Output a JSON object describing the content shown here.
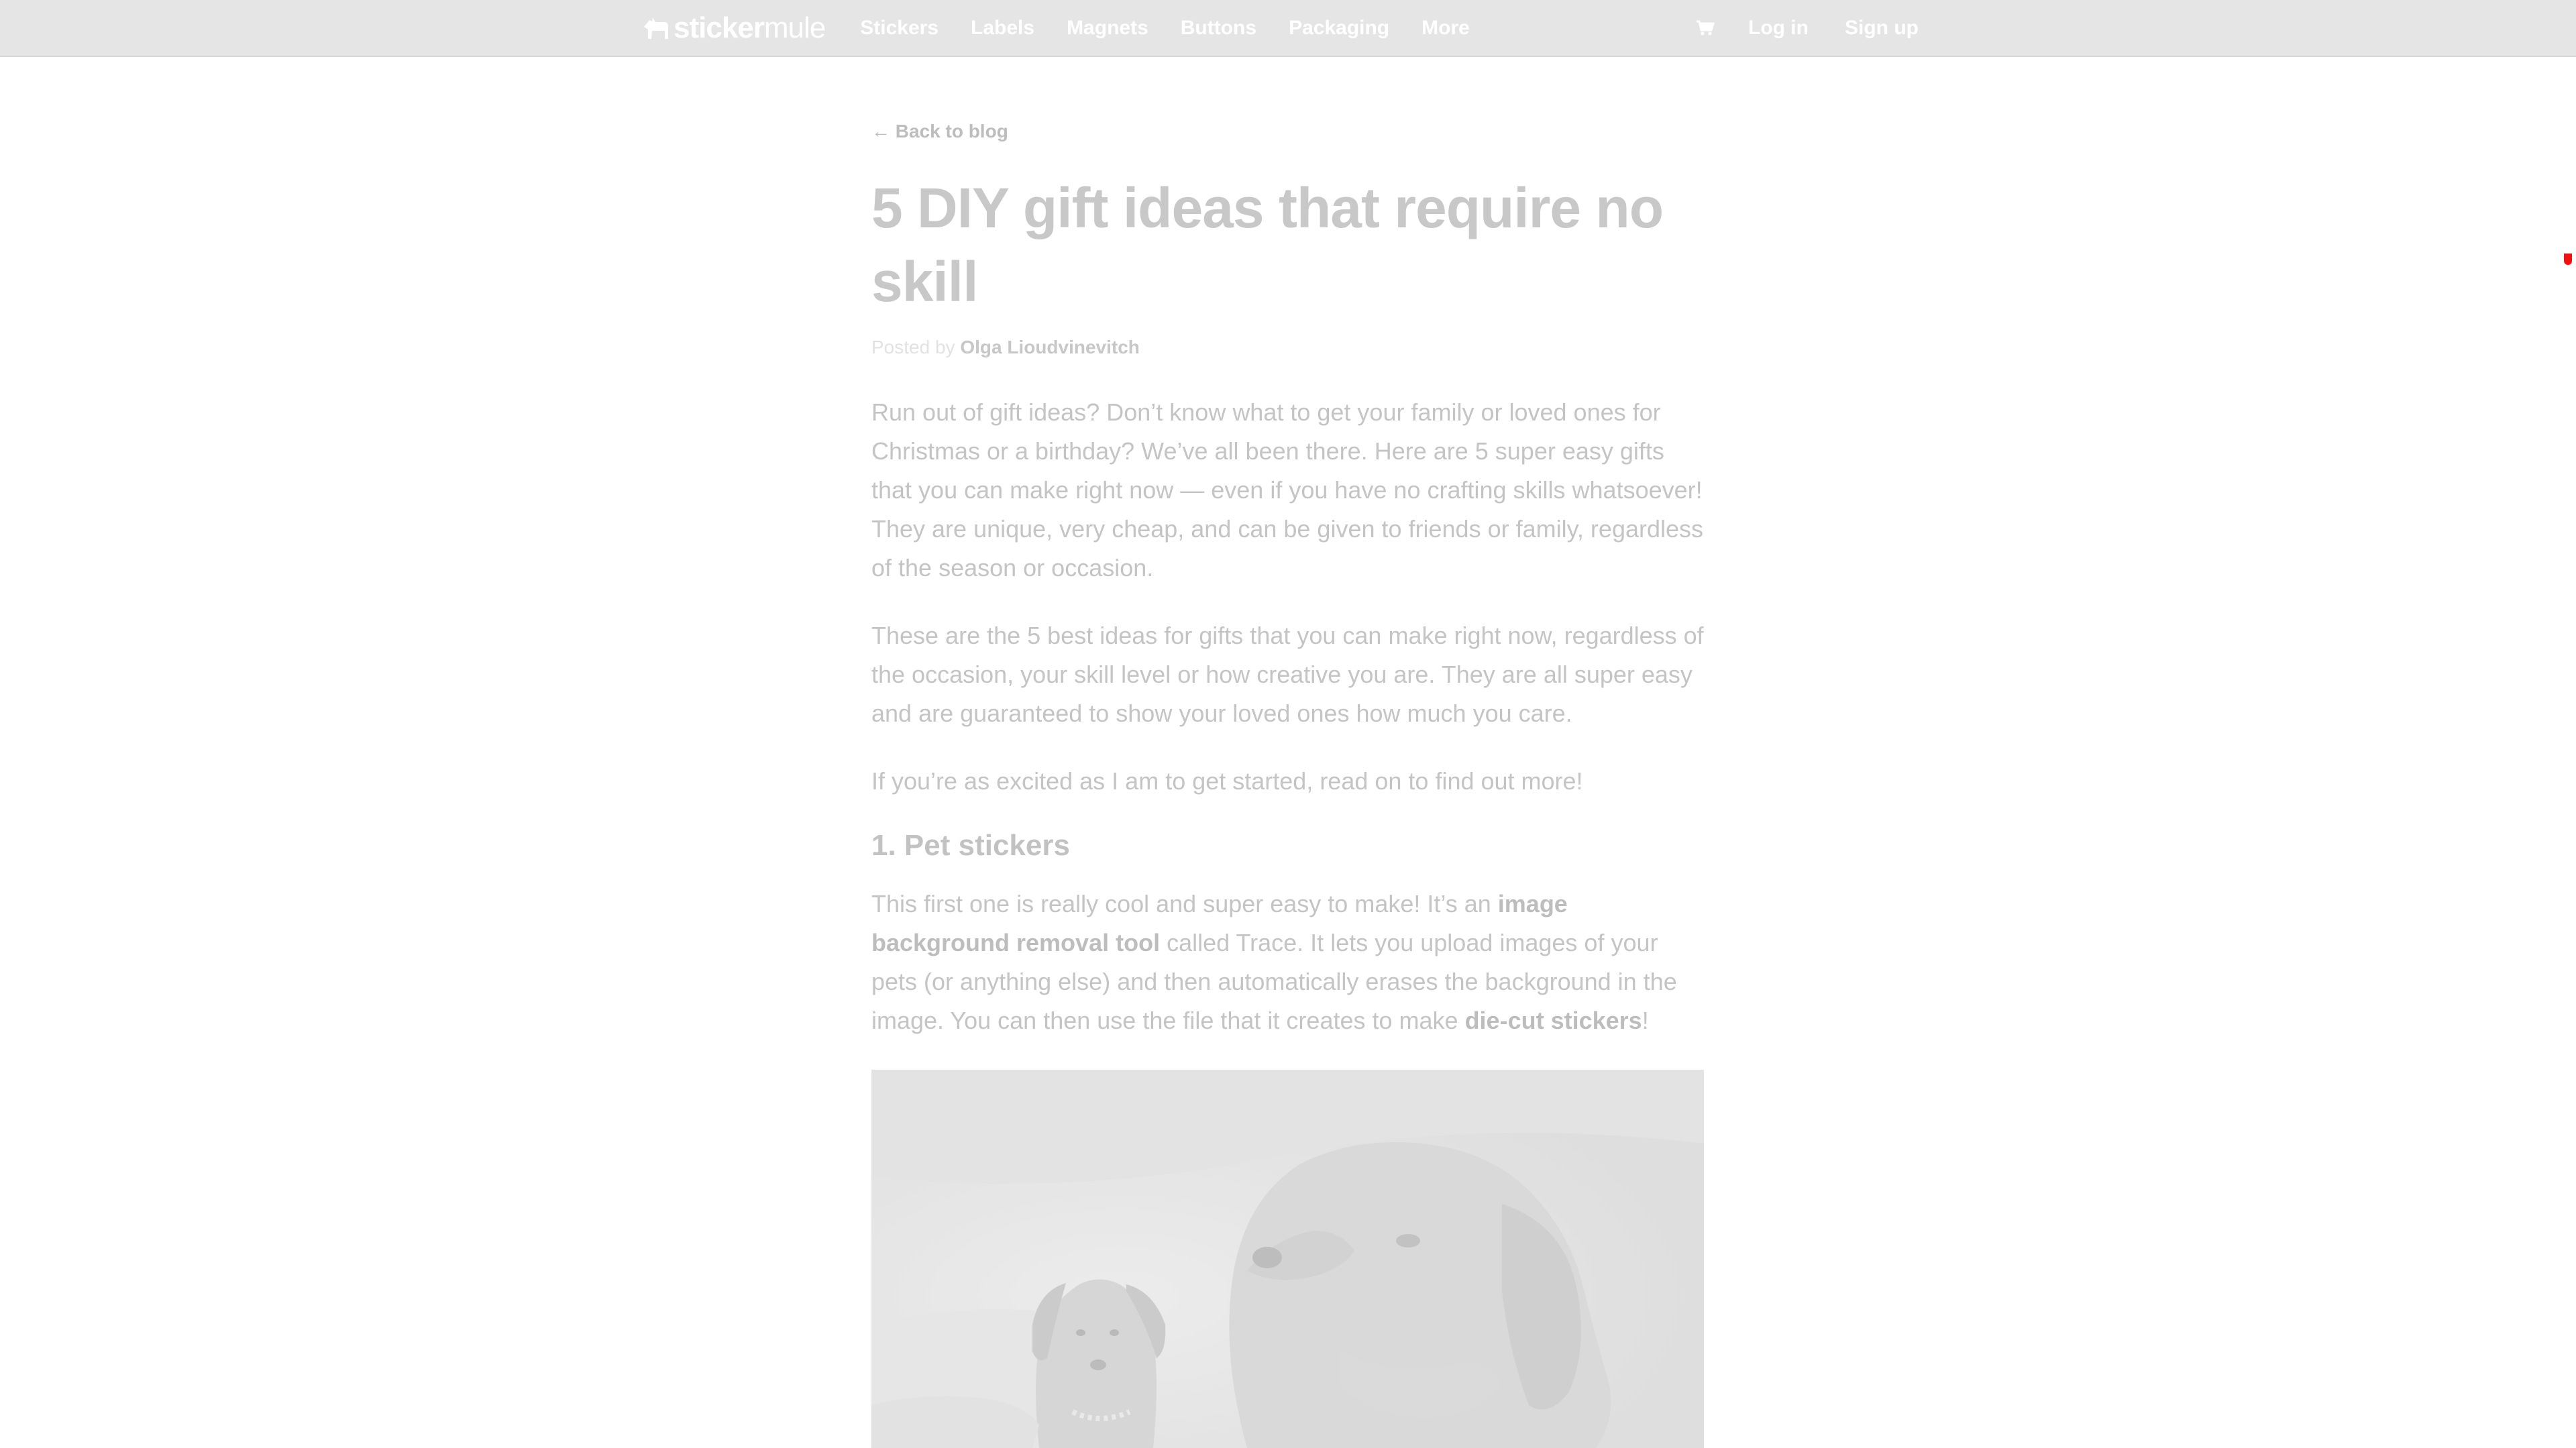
{
  "nav": {
    "logo": {
      "part1": "sticker",
      "part2": "mule"
    },
    "links": [
      "Stickers",
      "Labels",
      "Magnets",
      "Buttons",
      "Packaging",
      "More"
    ],
    "cart_icon": "cart-icon",
    "login": "Log in",
    "signup": "Sign up"
  },
  "article": {
    "back_link": "← Back to blog",
    "title": "5 DIY gift ideas that require no skill",
    "byline_prefix": "Posted by ",
    "author": "Olga Lioudvinevitch",
    "paragraphs": [
      "Run out of gift ideas? Don’t know what to get your family or loved ones for Christmas or a birthday? We’ve all been there. Here are 5 super easy gifts that you can make right now — even if you have no crafting skills whatsoever! They are unique, very cheap, and can be given to friends or family, regardless of the season or occasion.",
      "These are the 5 best ideas for gifts that you can make right now, regardless of the occasion, your skill level or how creative you are. They are all super easy and are guaranteed to show your loved ones how much you care.",
      "If you’re as excited as I am to get started, read on to find out more!"
    ],
    "section_heading": "1. Pet stickers",
    "section_paragraph": {
      "t1": "This first one is really cool and super easy to make! It’s an ",
      "link1": "image background removal tool",
      "t2": " called Trace. It lets you upload images of your pets (or anything else) and then automatically erases the background in the image. You can then use the file that it creates to make ",
      "link2": "die-cut stickers",
      "t3": "!"
    }
  },
  "colors": {
    "navbar_bg": "#e5e5e5",
    "nav_text": "#ffffff",
    "body_text": "#c4c4c4",
    "scroll_marker": "#ee1111"
  }
}
